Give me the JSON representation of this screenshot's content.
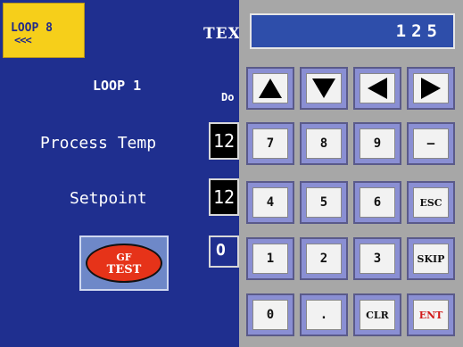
{
  "panel": {
    "loop_button": {
      "label": "LOOP 8",
      "arrows": "<<<"
    },
    "title_fragment": "TEX",
    "loop_heading": "LOOP 1",
    "column_fragment": "Do",
    "process_temp": {
      "label": "Process Temp",
      "value": "12"
    },
    "setpoint": {
      "label": "Setpoint",
      "value": "12"
    },
    "output_fragment": "O",
    "gf_test": {
      "line1": "GF",
      "line2": "TEST"
    }
  },
  "keypad": {
    "display_value": "125",
    "arrow_keys": [
      "up-arrow-icon",
      "down-arrow-icon",
      "left-arrow-icon",
      "right-arrow-icon"
    ],
    "rows": [
      [
        "7",
        "8",
        "9",
        "—"
      ],
      [
        "4",
        "5",
        "6",
        "ESC"
      ],
      [
        "1",
        "2",
        "3",
        "SKIP"
      ],
      [
        "0",
        ".",
        "CLR",
        "ENT"
      ]
    ]
  },
  "colors": {
    "panel_blue": "#1f2f8f",
    "loop_yellow": "#f6cf1a",
    "display_blue": "#2e4eaa",
    "ent_red": "#d21a1a",
    "gf_red": "#e63319"
  }
}
